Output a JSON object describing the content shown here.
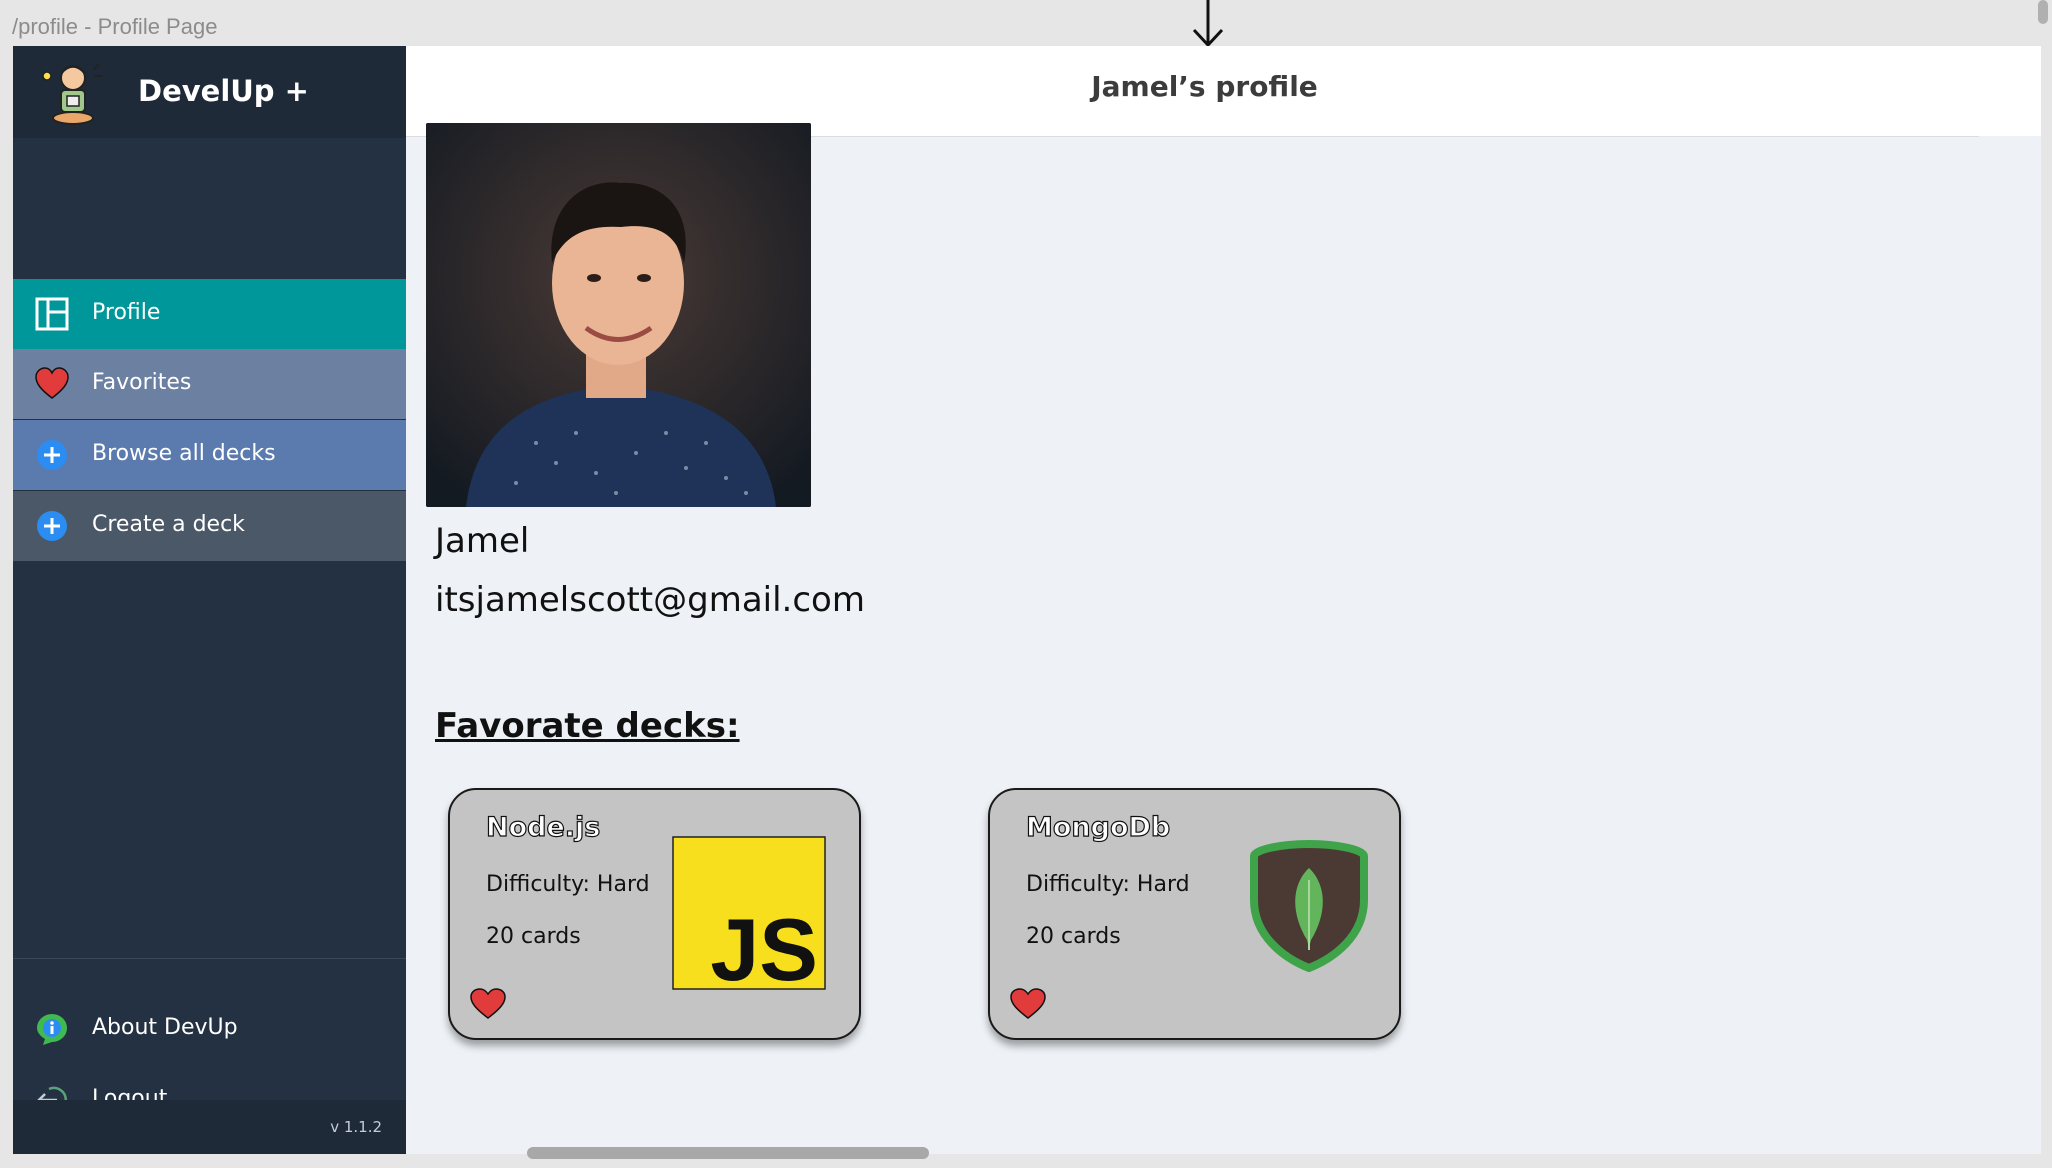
{
  "frame": {
    "label": "/profile - Profile Page"
  },
  "brand": {
    "name": "DevelUp +",
    "logo_icon": "developer-avatar-icon"
  },
  "sidebar": {
    "items": [
      {
        "label": "Profile",
        "icon": "layout-icon",
        "active": true,
        "color": "#00979b"
      },
      {
        "label": "Favorites",
        "icon": "heart-icon",
        "color": "#6c80a2"
      },
      {
        "label": "Browse all decks",
        "icon": "plus-circle-icon",
        "color": "#5b7bae"
      },
      {
        "label": "Create a deck",
        "icon": "plus-circle-icon",
        "color": "#4b5868"
      }
    ],
    "footer_items": [
      {
        "label": "About DevUp",
        "icon": "info-icon"
      },
      {
        "label": "Logout",
        "icon": "logout-icon"
      }
    ],
    "version": "v 1.1.2"
  },
  "header": {
    "title": "Jamel’s profile"
  },
  "profile": {
    "name": "Jamel",
    "email": "itsjamelscott@gmail.com"
  },
  "favorites": {
    "title": "Favorate decks:",
    "decks": [
      {
        "title": "Node.js",
        "difficulty": "Difficulty: Hard",
        "cards": "20 cards",
        "image_icon": "javascript-logo-icon"
      },
      {
        "title": "MongoDb",
        "difficulty": "Difficulty: Hard",
        "cards": "20 cards",
        "image_icon": "mongodb-leaf-icon"
      }
    ]
  },
  "colors": {
    "sidebar_bg": "#243142",
    "active": "#00979b",
    "heart": "#e23b3b",
    "card_bg": "#c4c4c4"
  }
}
